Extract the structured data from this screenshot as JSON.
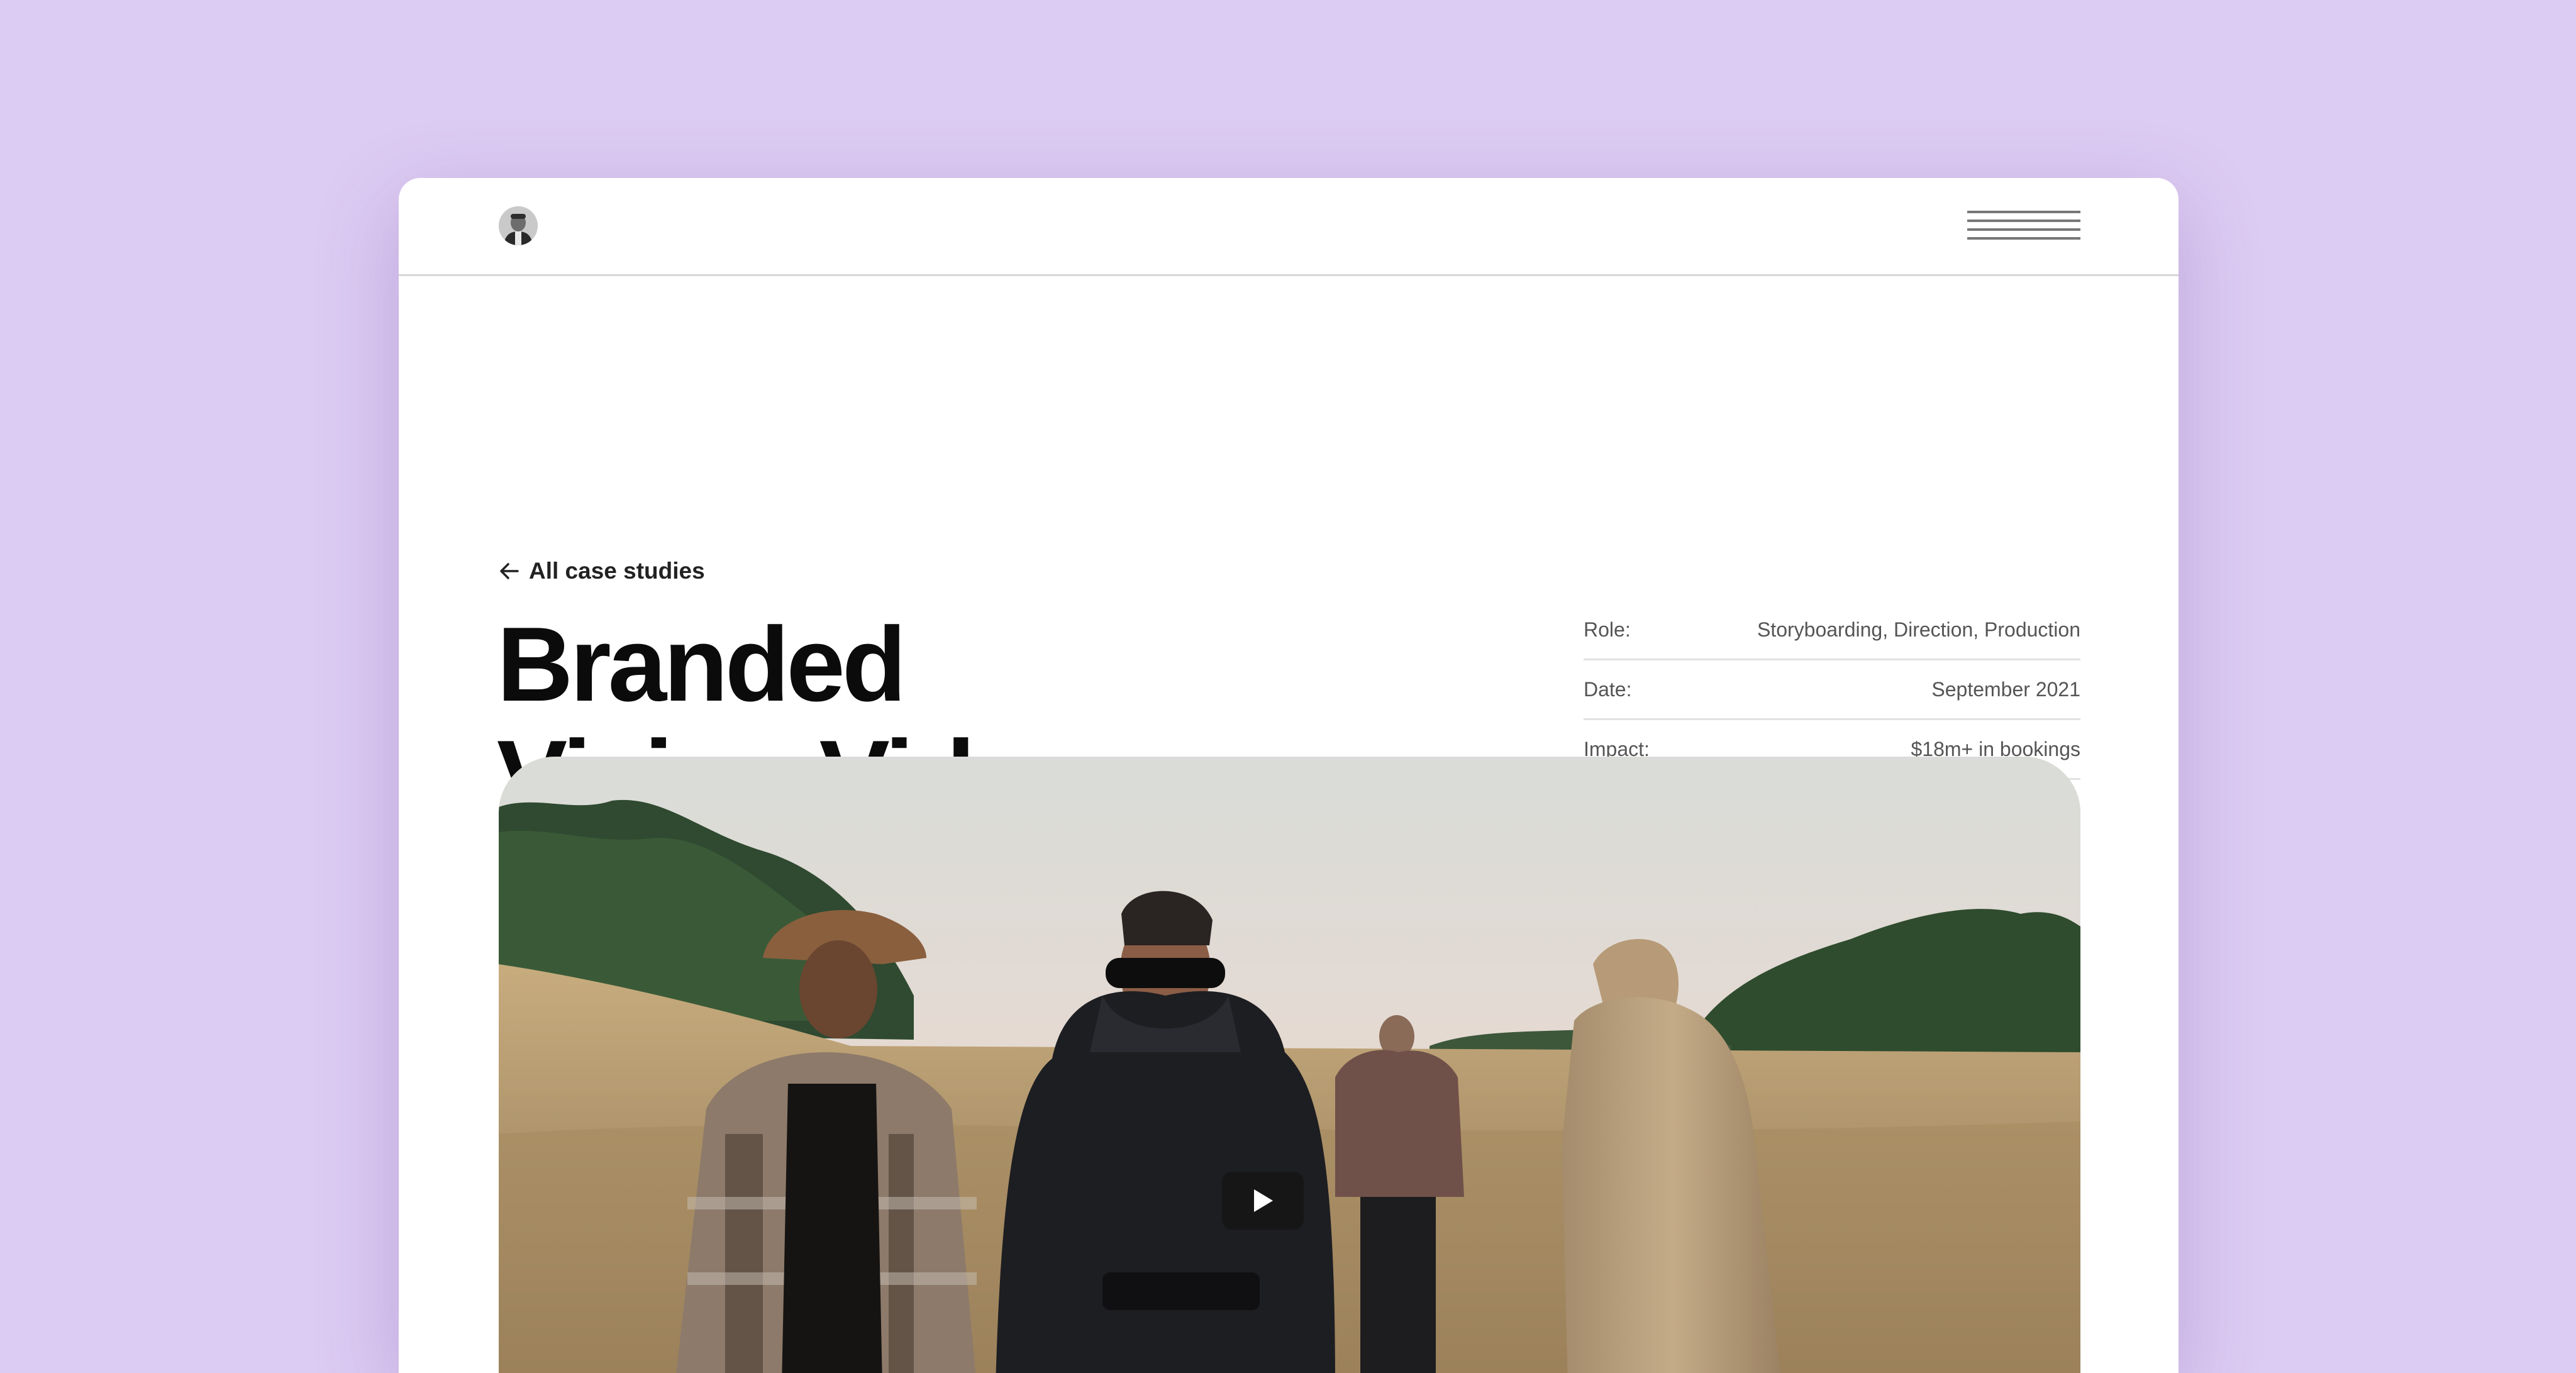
{
  "header": {
    "avatar_icon": "profile-avatar",
    "menu_icon": "hamburger-menu-icon"
  },
  "back_link": {
    "label": "All case studies",
    "icon": "arrow-left-icon"
  },
  "title": {
    "line1": "Branded",
    "line2": "Vision Videos"
  },
  "meta": [
    {
      "label": "Role:",
      "value": "Storyboarding, Direction, Production"
    },
    {
      "label": "Date:",
      "value": "September 2021"
    },
    {
      "label": "Impact:",
      "value": "$18m+ in bookings"
    }
  ],
  "video": {
    "play_icon": "play-icon"
  },
  "colors": {
    "background": "#dccbf2",
    "card": "#ffffff",
    "title": "#0b0b0b",
    "meta_text": "#555555"
  }
}
